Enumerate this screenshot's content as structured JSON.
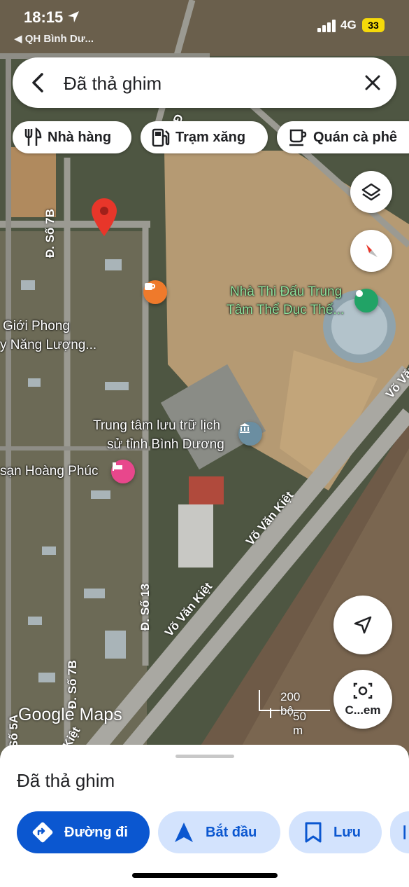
{
  "status_bar": {
    "time": "18:15",
    "back_app": "◀ QH Bình Dư...",
    "network": "4G",
    "battery": "33"
  },
  "search": {
    "query": "Đã thả ghim"
  },
  "chips": [
    {
      "label": "Nhà hàng",
      "icon": "fork-knife-icon"
    },
    {
      "label": "Trạm xăng",
      "icon": "gas-station-icon"
    },
    {
      "label": "Quán cà phê",
      "icon": "coffee-cup-icon"
    }
  ],
  "map": {
    "places": [
      {
        "name_line1": "Nhà Thi Đấu Trung",
        "name_line2": "Tâm Thể Dục Thể..."
      },
      {
        "name_line1": "Trung tâm lưu trữ lịch",
        "name_line2": "sử tỉnh Bình Dương"
      },
      {
        "name_line1": "sạn Hoàng Phúc",
        "name_line2": ""
      },
      {
        "name_line1": "Giới Phong",
        "name_line2": "y Năng Lượng..."
      }
    ],
    "roads": [
      "Đ. Số 7B",
      "Đ. Số 13",
      "Võ Văn Kiệt",
      "Võ Văn Kiệt",
      "Võ Văn",
      "Đ. Số 7B",
      "Số 5A",
      "Kiệt",
      "Đ"
    ],
    "scale_top": "200 bộ",
    "scale_bottom": "50 m",
    "logo": "Google Maps",
    "camera_label": "C...em"
  },
  "sheet": {
    "title": "Đã thả ghim",
    "actions": [
      {
        "label": "Đường đi",
        "icon": "directions-icon"
      },
      {
        "label": "Bắt đầu",
        "icon": "navigation-arrow-icon"
      },
      {
        "label": "Lưu",
        "icon": "bookmark-icon"
      }
    ]
  },
  "colors": {
    "accent": "#0b57d0",
    "light_blue": "#d3e3fd",
    "pin_red": "#e8362a",
    "green_label": "#8fe39e"
  }
}
